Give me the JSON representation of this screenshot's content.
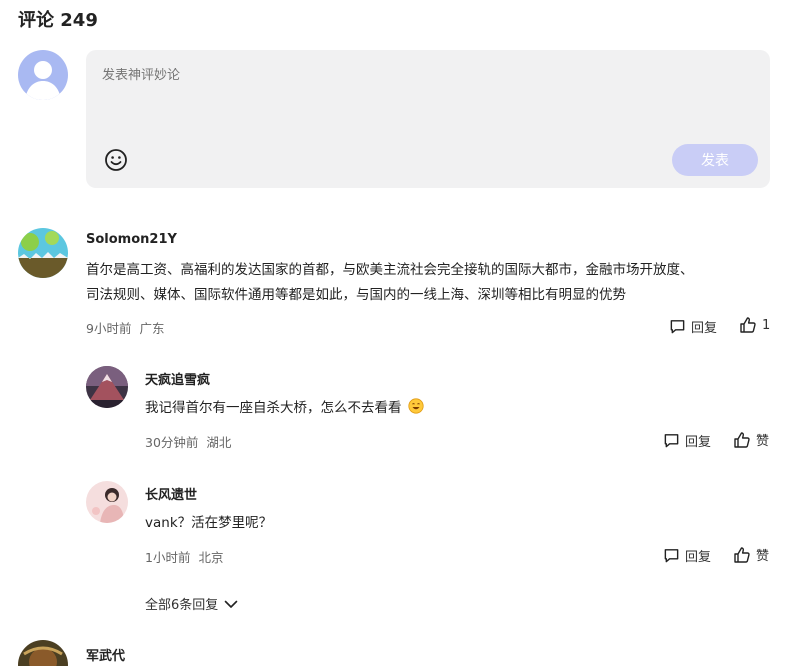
{
  "header": {
    "title": "评论 249"
  },
  "composer": {
    "placeholder": "发表神评妙论",
    "publish_label": "发表"
  },
  "comments": [
    {
      "user": "Solomon21Y",
      "lines": [
        "首尔是高工资、高福利的发达国家的首都，与欧美主流社会完全接轨的国际大都市，金融市场开放度、",
        "司法规则、媒体、国际软件通用等都是如此，与国内的一线上海、深圳等相比有明显的优势"
      ],
      "time": "9小时前",
      "location": "广东",
      "reply_label": "回复",
      "like_label": "1"
    }
  ],
  "replies": [
    {
      "user": "天疯追雪疯",
      "text": "我记得首尔有一座自杀大桥，怎么不去看看",
      "time": "30分钟前",
      "location": "湖北",
      "reply_label": "回复",
      "like_label": "赞"
    },
    {
      "user": "长风遗世",
      "text": "vank？活在梦里呢？",
      "time": "1小时前",
      "location": "北京",
      "reply_label": "回复",
      "like_label": "赞"
    }
  ],
  "more_replies_label": "全部6条回复",
  "next_comment": {
    "user": "军武代"
  },
  "colors": {
    "publish_disabled": "#c9cdf6",
    "composer_bg": "#f1f1f2"
  }
}
